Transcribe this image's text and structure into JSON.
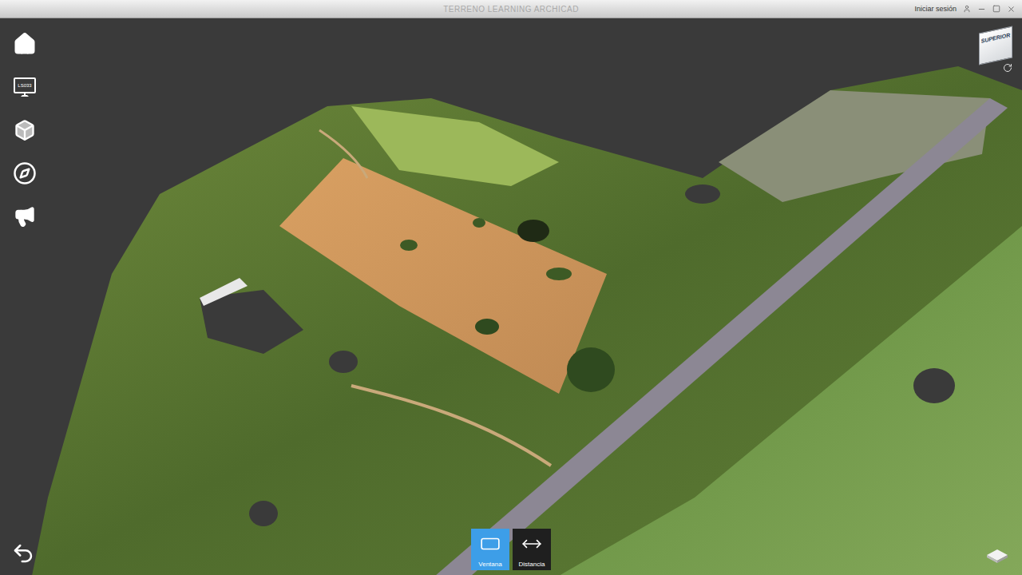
{
  "window": {
    "title": "TERRENO LEARNING ARCHICAD",
    "account": "Iniciar sesión"
  },
  "sidebar": {
    "monitor_label": "LS033"
  },
  "view_cube": {
    "face": "SUPERIOR"
  },
  "tools": [
    {
      "label": "Ventana",
      "selected": true
    },
    {
      "label": "Distancia",
      "selected": false
    }
  ]
}
